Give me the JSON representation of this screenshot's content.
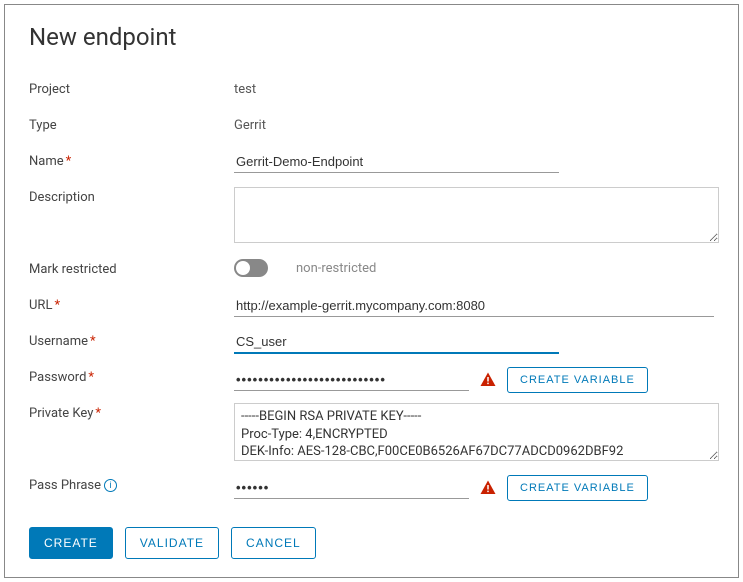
{
  "title": "New endpoint",
  "labels": {
    "project": "Project",
    "type": "Type",
    "name": "Name",
    "description": "Description",
    "mark_restricted": "Mark restricted",
    "url": "URL",
    "username": "Username",
    "password": "Password",
    "private_key": "Private Key",
    "pass_phrase": "Pass Phrase"
  },
  "values": {
    "project": "test",
    "type": "Gerrit",
    "name": "Gerrit-Demo-Endpoint",
    "description": "",
    "restricted_state": "non-restricted",
    "url": "http://example-gerrit.mycompany.com:8080",
    "username": "CS_user",
    "password": "•••••••••••••••••••••••••••",
    "private_key": "-----BEGIN RSA PRIVATE KEY-----\nProc-Type: 4,ENCRYPTED\nDEK-Info: AES-128-CBC,F00CE0B6526AF67DC77ADCD0962DBF92",
    "pass_phrase": "••••••"
  },
  "buttons": {
    "create_variable": "CREATE VARIABLE",
    "create": "CREATE",
    "validate": "VALIDATE",
    "cancel": "CANCEL"
  }
}
